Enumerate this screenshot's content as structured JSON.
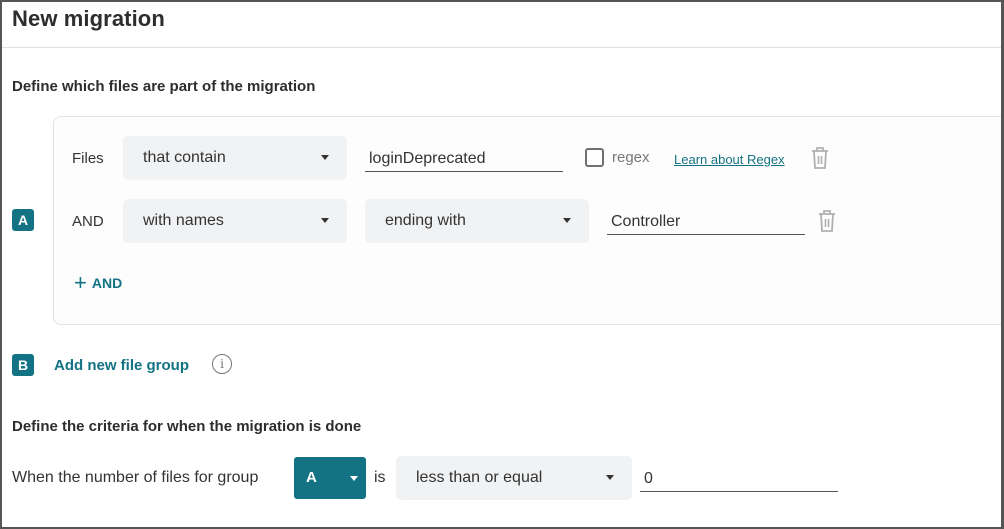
{
  "header": {
    "title": "New migration"
  },
  "files_section": {
    "title": "Define which files are part of the migration",
    "groups": [
      {
        "badge": "A",
        "rows": [
          {
            "label": "Files",
            "selector": "that contain",
            "value": "loginDeprecated",
            "regex_label": "regex",
            "regex_checked": false,
            "regex_link": "Learn about Regex",
            "delete_icon": "trash-icon"
          },
          {
            "label": "AND",
            "selector": "with names",
            "operator": "ending with",
            "value": "Controller",
            "delete_icon": "trash-icon"
          }
        ],
        "add_condition_label": "AND",
        "add_condition_icon": "plus-icon"
      }
    ],
    "new_group": {
      "badge": "B",
      "label": "Add new file group",
      "info_icon": "info-icon",
      "info_glyph": "i"
    }
  },
  "criteria_section": {
    "title": "Define the criteria for when the migration is done",
    "prefix": "When the number of files for group",
    "group": "A",
    "connector": "is",
    "comparator": "less than or equal",
    "threshold": "0"
  },
  "colors": {
    "accent": "#137384",
    "select_bg": "#f1f2f4",
    "text": "#2d2d2d"
  }
}
